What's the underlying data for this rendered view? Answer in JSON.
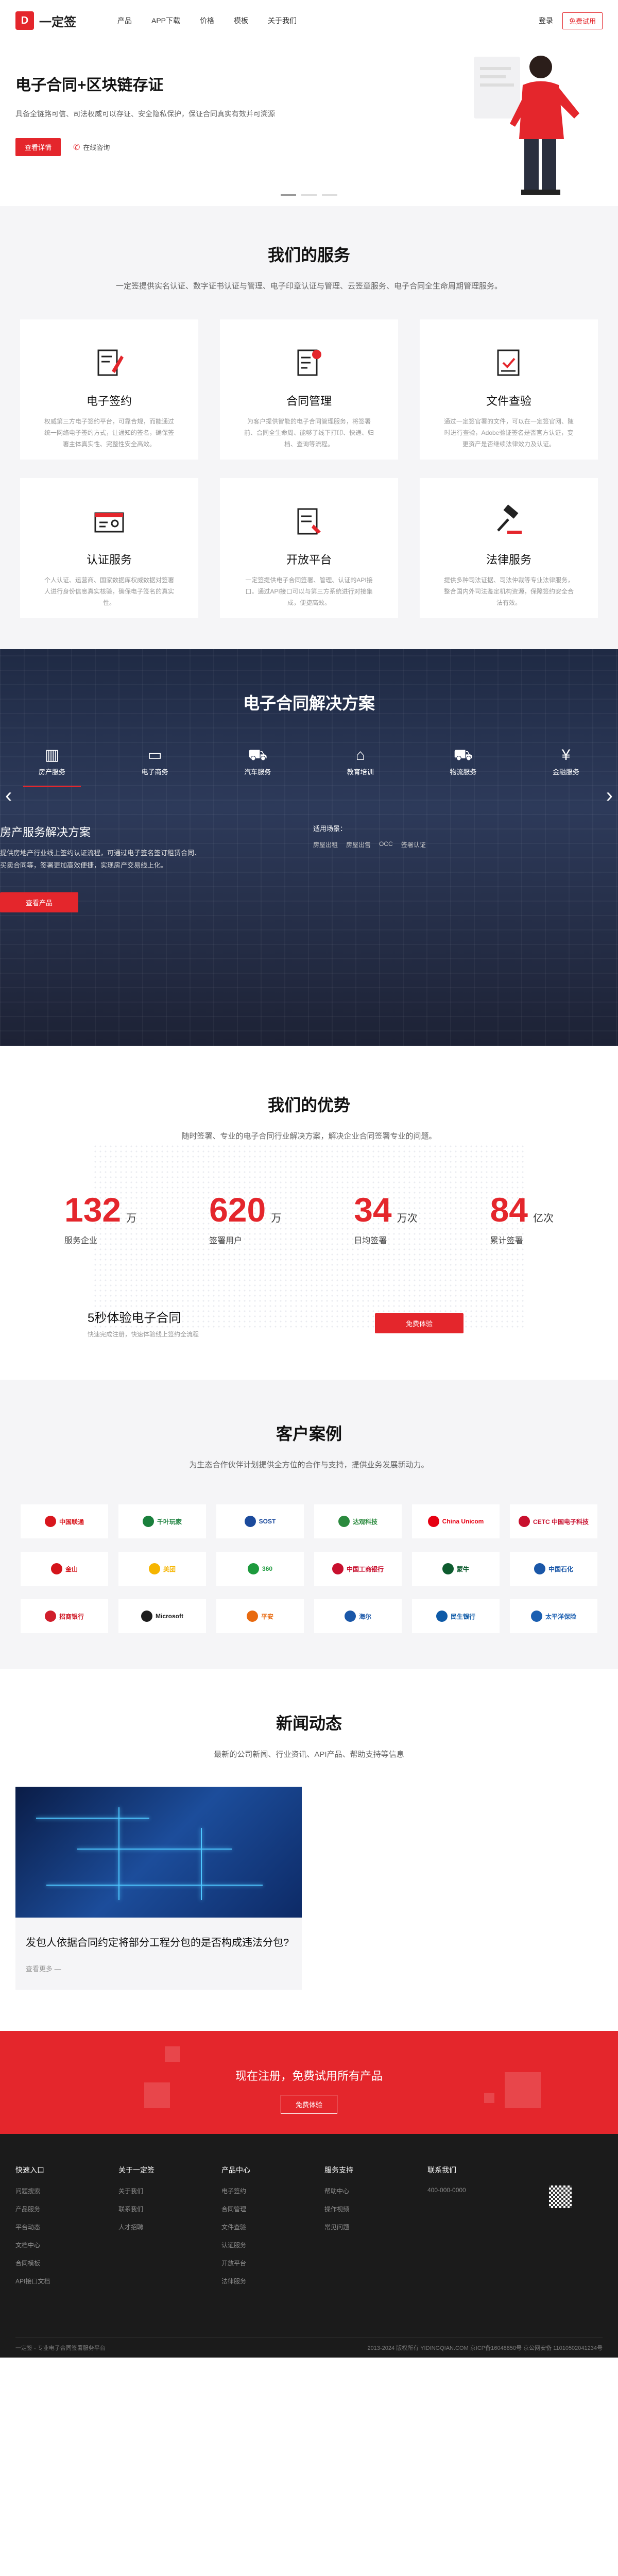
{
  "nav": {
    "logo_mark": "D",
    "logo_text": "一定签",
    "links": [
      "产品",
      "APP下载",
      "价格",
      "模板",
      "关于我们"
    ],
    "login": "登录",
    "trial": "免费试用"
  },
  "hero": {
    "title": "电子合同+区块链存证",
    "desc": "具备全链路可信、司法权威可以存证、安全隐私保护，保证合同真实有效并可溯源",
    "btn_detail": "查看详情",
    "btn_consult": "在线咨询"
  },
  "services": {
    "title": "我们的服务",
    "subtitle": "一定签提供实名认证、数字证书认证与管理、电子印章认证与管理、云签章服务、电子合同全生命周期管理服务。",
    "items": [
      {
        "name": "电子签约",
        "desc": "权威第三方电子签约平台，可靠合规，而能通过统一网络电子签约方式，让通知的签名，确保签署主体真实性、完整性安全高效。"
      },
      {
        "name": "合同管理",
        "desc": "为客户提供智能的电子合同管理服务，将签署前、合同全生命周、能够了线下打印、快递、归档、查询等流程。"
      },
      {
        "name": "文件查验",
        "desc": "通过一定签官署的文件，可以在一定签官网、随时进行查验，Adobe验证签名是否官方认证，变更资产是否继续法律效力及认证。"
      },
      {
        "name": "认证服务",
        "desc": "个人认证、运营商、国家数据库权威数据对签署人进行身份信息真实核验，确保电子签名的真实性。"
      },
      {
        "name": "开放平台",
        "desc": "一定签提供电子合同签署、管理、认证的API接口。通过API接口可以与第三方系统进行对接集成，便捷高效。"
      },
      {
        "name": "法律服务",
        "desc": "提供多种司法证据、司法仲裁等专业法律服务，整合国内外司法鉴定机构资源，保障签约安全合法有效。"
      }
    ]
  },
  "solutions": {
    "title": "电子合同解决方案",
    "tabs": [
      {
        "label": "房产服务",
        "icon": "building-icon"
      },
      {
        "label": "电子商务",
        "icon": "monitor-icon"
      },
      {
        "label": "汽车服务",
        "icon": "car-icon"
      },
      {
        "label": "教育培训",
        "icon": "graduation-cap-icon"
      },
      {
        "label": "物流服务",
        "icon": "truck-icon"
      },
      {
        "label": "金融服务",
        "icon": "yen-icon"
      }
    ],
    "active_title": "房产服务解决方案",
    "active_desc": "提供房地产行业线上签约认证流程，可通过电子签名签订租赁合同、买卖合同等，签署更加高效便捷，实现房产交易线上化。",
    "btn": "查看产品",
    "scene_label": "适用场景：",
    "scenes": [
      "房屋出租",
      "房屋出售",
      "OCC",
      "签署认证"
    ]
  },
  "advantages": {
    "title": "我们的优势",
    "subtitle": "随时签署、专业的电子合同行业解决方案，解决企业合同签署专业的问题。",
    "stats": [
      {
        "num": "132",
        "unit": "万",
        "label": "服务企业"
      },
      {
        "num": "620",
        "unit": "万",
        "label": "签署用户"
      },
      {
        "num": "34",
        "unit": "万次",
        "label": "日均签署"
      },
      {
        "num": "84",
        "unit": "亿次",
        "label": "累计签署"
      }
    ],
    "try_title": "5秒体验电子合同",
    "try_desc": "快速完成注册，快速体验线上签约全流程",
    "try_btn": "免费体验"
  },
  "cases": {
    "title": "客户案例",
    "subtitle": "为生态合作伙伴计划提供全方位的合作与支持，提供业务发展新动力。",
    "logos": [
      {
        "name": "中国联通",
        "color": "#d8161d"
      },
      {
        "name": "千叶玩家",
        "color": "#1a7f3c"
      },
      {
        "name": "SOST",
        "color": "#1b4a9c"
      },
      {
        "name": "达观科技",
        "color": "#2b8a3e"
      },
      {
        "name": "China Unicom",
        "color": "#e60012"
      },
      {
        "name": "CETC 中国电子科技",
        "color": "#c8102e"
      },
      {
        "name": "金山",
        "color": "#d4141b"
      },
      {
        "name": "美团",
        "color": "#f6b500"
      },
      {
        "name": "360",
        "color": "#1d9a3d"
      },
      {
        "name": "中国工商银行",
        "color": "#c8102e"
      },
      {
        "name": "蒙牛",
        "color": "#0d5b2e"
      },
      {
        "name": "中国石化",
        "color": "#1a57a8"
      },
      {
        "name": "招商银行",
        "color": "#d01e2b"
      },
      {
        "name": "Microsoft",
        "color": "#1d1d1d"
      },
      {
        "name": "平安",
        "color": "#e86a10"
      },
      {
        "name": "海尔",
        "color": "#1a57a8"
      },
      {
        "name": "民生银行",
        "color": "#0e5aa7"
      },
      {
        "name": "太平洋保险",
        "color": "#1b5fb1"
      }
    ]
  },
  "news": {
    "title": "新闻动态",
    "subtitle": "最新的公司新闻、行业资讯、API产品、帮助支持等信息",
    "card_title": "发包人依据合同约定将部分工程分包的是否构成违法分包?",
    "card_more": "查看更多 —"
  },
  "cta": {
    "title": "现在注册，免费试用所有产品",
    "btn": "免费体验"
  },
  "footer": {
    "cols": [
      {
        "title": "快速入口",
        "items": [
          "问题搜索",
          "产品服务",
          "平台动态",
          "文档中心",
          "合同模板",
          "API接口文档"
        ]
      },
      {
        "title": "关于一定签",
        "items": [
          "关于我们",
          "联系我们",
          "人才招聘"
        ]
      },
      {
        "title": "产品中心",
        "items": [
          "电子签约",
          "合同管理",
          "文件查验",
          "认证服务",
          "开放平台",
          "法律服务"
        ]
      },
      {
        "title": "服务支持",
        "items": [
          "帮助中心",
          "操作视频",
          "常见问题"
        ]
      },
      {
        "title": "联系我们",
        "items": [
          "400-000-0000"
        ]
      }
    ],
    "bottom_left": "一定签 - 专业电子合同签署服务平台",
    "bottom_right": "2013-2024 版权所有 YIDINGQIAN.COM 京ICP备16048850号 京公网安备 11010502041234号"
  }
}
